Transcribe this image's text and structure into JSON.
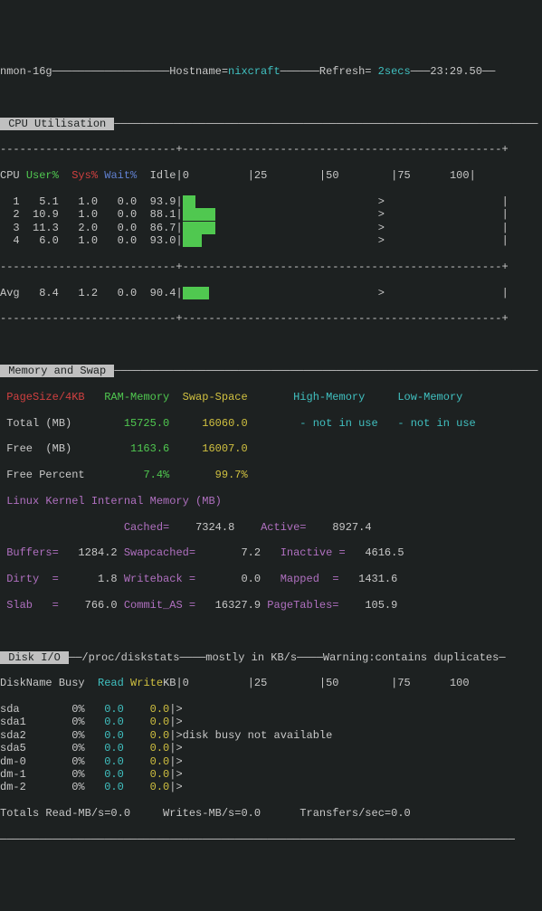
{
  "header": {
    "prog": "nmon-16g",
    "hostname_label": "Hostname=",
    "hostname": "nixcraft",
    "refresh_label": "Refresh=",
    "refresh": " 2secs",
    "time": "23:29.50"
  },
  "cpu": {
    "title": " CPU Utilisation ",
    "cols": {
      "cpu": "CPU",
      "user": "User%",
      "sys": "Sys%",
      "wait": "Wait%",
      "idle": "Idle"
    },
    "scale": {
      "s0": "0",
      "s25": "25",
      "s50": "50",
      "s75": "75",
      "s100": "100"
    },
    "rows": [
      {
        "id": "1",
        "user": "5.1",
        "sys": "1.0",
        "wait": "0.0",
        "idle": "93.9",
        "bar": "UU"
      },
      {
        "id": "2",
        "user": "10.9",
        "sys": "1.0",
        "wait": "0.0",
        "idle": "88.1",
        "bar": "UUUUU"
      },
      {
        "id": "3",
        "user": "11.3",
        "sys": "2.0",
        "wait": "0.0",
        "idle": "86.7",
        "bar": "UUUUU"
      },
      {
        "id": "4",
        "user": "6.0",
        "sys": "1.0",
        "wait": "0.0",
        "idle": "93.0",
        "bar": "UUU"
      }
    ],
    "avg": {
      "id": "Avg",
      "user": "8.4",
      "sys": "1.2",
      "wait": "0.0",
      "idle": "90.4",
      "bar": "UUUU"
    }
  },
  "mem": {
    "title": " Memory and Swap ",
    "pagesize": "PageSize/4KB",
    "ram_hdr": "RAM-Memory",
    "swap_hdr": "Swap-Space",
    "high_hdr": "High-Memory",
    "low_hdr": "Low-Memory",
    "total_lbl": "Total (MB)",
    "total_ram": "15725.0",
    "total_swap": "16060.0",
    "not_in_use1": "- not in use",
    "not_in_use2": "- not in use",
    "free_lbl": "Free  (MB)",
    "free_ram": "1163.6",
    "free_swap": "16007.0",
    "freepct_lbl": "Free Percent",
    "freepct_ram": "7.4%",
    "freepct_swap": "99.7%",
    "kernel_hdr": "Linux Kernel Internal Memory (MB)",
    "cached_lbl": "Cached=",
    "cached": "7324.8",
    "active_lbl": "Active=",
    "active": "8927.4",
    "buffers_lbl": "Buffers=",
    "buffers": "1284.2",
    "swapcached_lbl": "Swapcached=",
    "swapcached": "7.2",
    "inactive_lbl": "Inactive =",
    "inactive": "4616.5",
    "dirty_lbl": "Dirty  =",
    "dirty": "1.8",
    "writeback_lbl": "Writeback =",
    "writeback": "0.0",
    "mapped_lbl": "Mapped  =",
    "mapped": "1431.6",
    "slab_lbl": "Slab   =",
    "slab": "766.0",
    "commit_lbl": "Commit_AS =",
    "commit": "16327.9",
    "pagetables_lbl": "PageTables=",
    "pagetables": "105.9"
  },
  "disk": {
    "title": " Disk I/O ",
    "src": "/proc/diskstats",
    "units": "mostly in KB/s",
    "warn": "Warning:contains duplicates",
    "cols": {
      "name": "DiskName",
      "busy": "Busy",
      "read": "Read",
      "write": "Write",
      "kb": "KB"
    },
    "scale": {
      "s0": "0",
      "s25": "25",
      "s50": "50",
      "s75": "75",
      "s100": "100"
    },
    "rows": [
      {
        "name": "sda",
        "busy": "0%",
        "read": "0.0",
        "write": "0.0"
      },
      {
        "name": "sda1",
        "busy": "0%",
        "read": "0.0",
        "write": "0.0"
      },
      {
        "name": "sda2",
        "busy": "0%",
        "read": "0.0",
        "write": "0.0"
      },
      {
        "name": "sda5",
        "busy": "0%",
        "read": "0.0",
        "write": "0.0"
      },
      {
        "name": "dm-0",
        "busy": "0%",
        "read": "0.0",
        "write": "0.0"
      },
      {
        "name": "dm-1",
        "busy": "0%",
        "read": "0.0",
        "write": "0.0"
      },
      {
        "name": "dm-2",
        "busy": "0%",
        "read": "0.0",
        "write": "0.0"
      }
    ],
    "busy_msg": "disk busy not available",
    "totals": {
      "read_lbl": "Totals Read-MB/s=",
      "read": "0.0",
      "write_lbl": "Writes-MB/s=",
      "write": "0.0",
      "xfer_lbl": "Transfers/sec=",
      "xfer": "0.0"
    }
  }
}
